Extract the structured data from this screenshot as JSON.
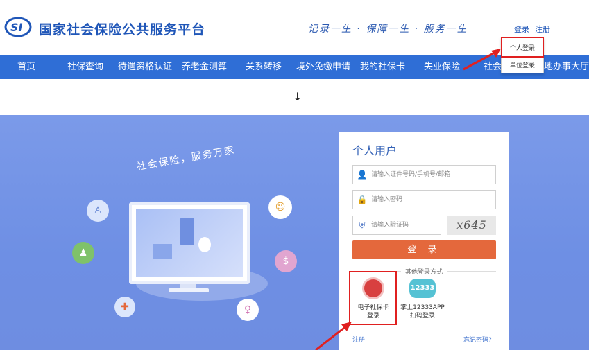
{
  "header": {
    "site_title": "国家社会保险公共服务平台",
    "logo_text": "SI",
    "slogan": "记录一生 · 保障一生 · 服务一生",
    "login_label": "登录",
    "register_label": "注册"
  },
  "nav": {
    "items": [
      "首页",
      "社保查询",
      "待遇资格认证",
      "养老金测算",
      "关系转移",
      "境外免缴申请",
      "我的社保卡",
      "失业保险",
      "社会",
      "地办事大厅"
    ]
  },
  "dropdown": {
    "items": [
      "个人登录",
      "单位登录"
    ]
  },
  "arrow_glyph": "↓",
  "hero": {
    "slogan": "社会保险，服务万家"
  },
  "login_card": {
    "title": "个人用户",
    "account_placeholder": "请输入证件号码/手机号/邮箱",
    "password_placeholder": "请输入密码",
    "captcha_placeholder": "请输入验证码",
    "captcha_text": "x645",
    "login_button": "登  录",
    "other_methods_title": "其他登录方式",
    "option_ecard_line1": "电子社保卡",
    "option_ecard_line2": "登录",
    "option_app_line1": "掌上12333APP",
    "option_app_line2": "扫码登录",
    "app_badge": "12333",
    "register_link": "注册",
    "forgot_link": "忘记密码?"
  },
  "colors": {
    "brand_blue": "#1f56b8",
    "nav_blue": "#2f6ed6",
    "login_orange": "#e4683c",
    "highlight_red": "#e02020"
  }
}
